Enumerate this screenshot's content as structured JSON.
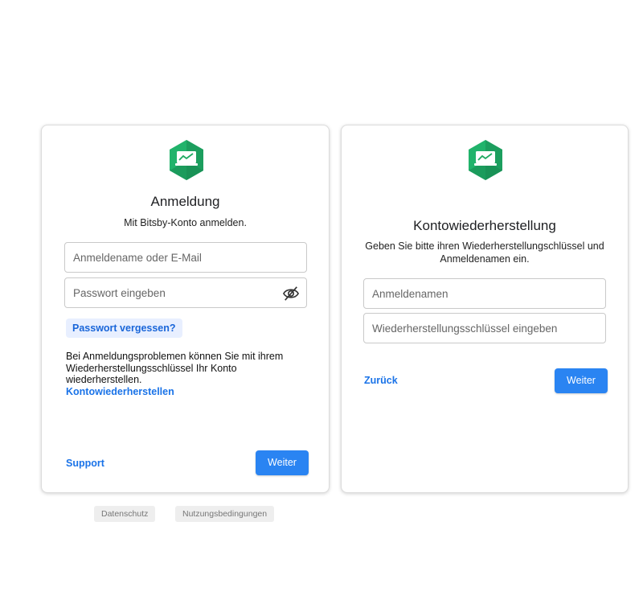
{
  "login": {
    "title": "Anmeldung",
    "subtitle": "Mit Bitsby-Konto anmelden.",
    "username_placeholder": "Anmeldename oder E-Mail",
    "password_placeholder": "Passwort eingeben",
    "forgot_password": "Passwort vergessen?",
    "help_text": "Bei Anmeldungsproblemen können Sie mit ihrem Wiederherstellungsschlüssel Ihr Konto wiederherstellen.",
    "recover_link": "Kontowiederherstellen",
    "support_link": "Support",
    "next_button": "Weiter"
  },
  "recovery": {
    "title": "Kontowiederherstellung",
    "subtitle": "Geben Sie bitte ihren Wiederherstellungschlüssel und Anmeldenamen ein.",
    "username_placeholder": "Anmeldenamen",
    "key_placeholder": "Wiederherstellungsschlüssel eingeben",
    "back_link": "Zurück",
    "next_button": "Weiter"
  },
  "footer": {
    "privacy": "Datenschutz",
    "terms": "Nutzungsbedingungen"
  },
  "colors": {
    "accent": "#2a84f2",
    "link": "#1a73e8",
    "logo_green": "#1faa62"
  },
  "icons": {
    "logo": "bitsby-logo-icon",
    "password_toggle": "eye-off-icon"
  }
}
